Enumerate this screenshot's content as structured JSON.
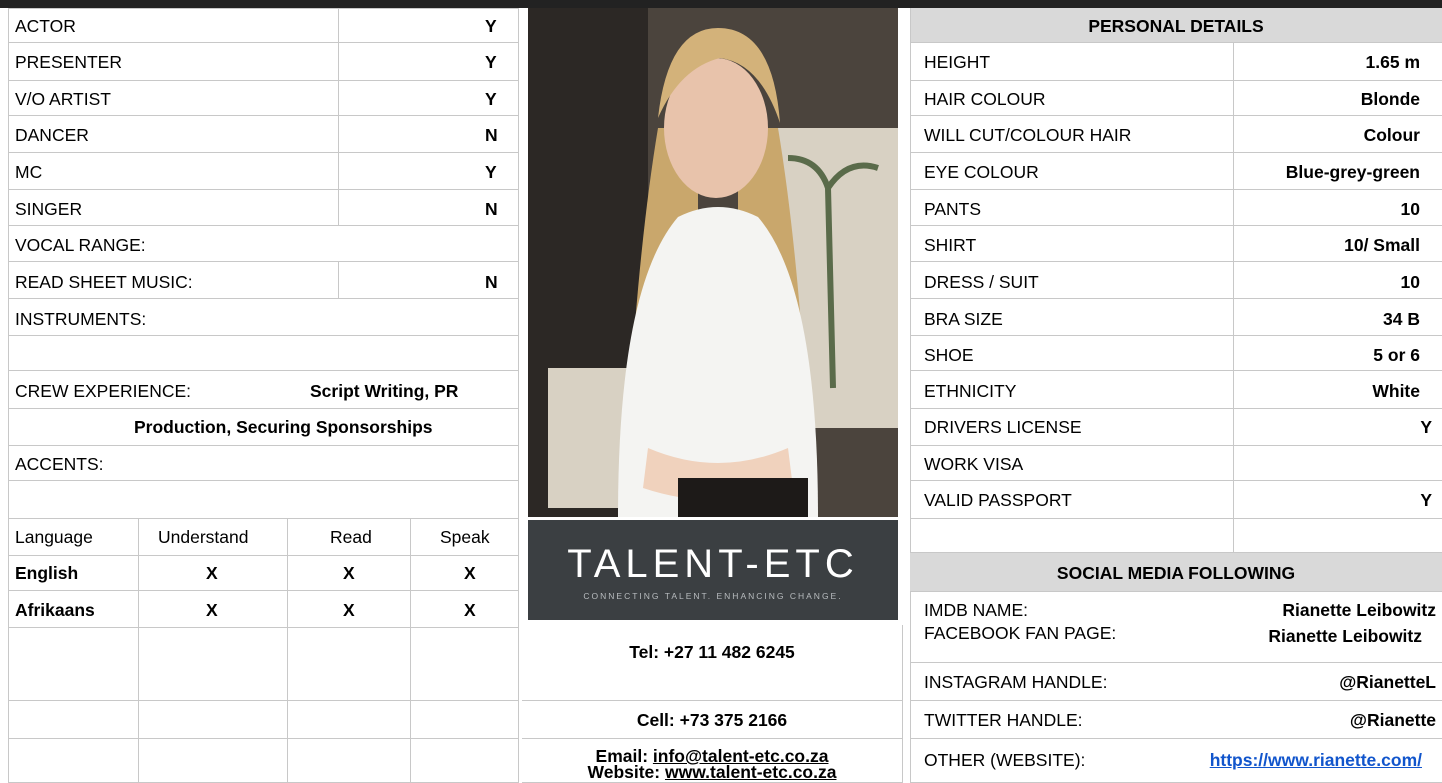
{
  "skills": [
    {
      "label": "ACTOR",
      "value": "Y"
    },
    {
      "label": "PRESENTER",
      "value": "Y"
    },
    {
      "label": "V/O ARTIST",
      "value": "Y"
    },
    {
      "label": "DANCER",
      "value": "N"
    },
    {
      "label": "MC",
      "value": "Y"
    },
    {
      "label": "SINGER",
      "value": "N"
    }
  ],
  "vocal_range_label": "VOCAL RANGE:",
  "read_sheet_music": {
    "label": "READ SHEET MUSIC:",
    "value": "N"
  },
  "instruments_label": "INSTRUMENTS:",
  "crew": {
    "label": "CREW EXPERIENCE:",
    "line1": "Script Writing, PR",
    "line2": "Production, Securing Sponsorships"
  },
  "accents_label": "ACCENTS:",
  "languages": {
    "headers": [
      "Language",
      "Understand",
      "Read",
      "Speak"
    ],
    "rows": [
      {
        "name": "English",
        "understand": "X",
        "read": "X",
        "speak": "X"
      },
      {
        "name": "Afrikaans",
        "understand": "X",
        "read": "X",
        "speak": "X"
      }
    ]
  },
  "logo": {
    "title": "TALENT-ETC",
    "tagline": "CONNECTING TALENT. ENHANCING CHANGE."
  },
  "contact": {
    "tel": "Tel: +27 11 482 6245",
    "cell": "Cell: +73 375 2166",
    "email_label": "Email: ",
    "email": "info@talent-etc.co.za",
    "website_label": "Website: ",
    "website": "www.talent-etc.co.za"
  },
  "personal": {
    "title": "PERSONAL DETAILS",
    "rows": [
      {
        "label": "HEIGHT",
        "value": "1.65 m"
      },
      {
        "label": "HAIR COLOUR",
        "value": "Blonde"
      },
      {
        "label": "WILL CUT/COLOUR HAIR",
        "value": "Colour"
      },
      {
        "label": "EYE COLOUR",
        "value": "Blue-grey-green"
      },
      {
        "label": "PANTS",
        "value": "10"
      },
      {
        "label": "SHIRT",
        "value": "10/ Small"
      },
      {
        "label": "DRESS / SUIT",
        "value": "10"
      },
      {
        "label": "BRA SIZE",
        "value": "34 B"
      },
      {
        "label": "SHOE",
        "value": "5 or 6"
      },
      {
        "label": "ETHNICITY",
        "value": "White"
      },
      {
        "label": "DRIVERS LICENSE",
        "value": "Y"
      },
      {
        "label": "WORK VISA",
        "value": ""
      },
      {
        "label": "VALID PASSPORT",
        "value": "Y"
      }
    ]
  },
  "social": {
    "title": "SOCIAL MEDIA FOLLOWING",
    "rows": [
      {
        "label": "IMDB NAME:",
        "value": "Rianette Leibowitz"
      },
      {
        "label": "FACEBOOK FAN PAGE:",
        "value": "Rianette Leibowitz"
      },
      {
        "label": "INSTAGRAM HANDLE:",
        "value": "@RianetteL"
      },
      {
        "label": "TWITTER HANDLE:",
        "value": "@Rianette"
      },
      {
        "label": "OTHER (WEBSITE):",
        "value": "https://www.rianette.com/"
      }
    ]
  },
  "colors": {
    "header_gray": "#d9d9d9",
    "logo_bg": "#3b3f42",
    "link_blue": "#1155cc"
  }
}
